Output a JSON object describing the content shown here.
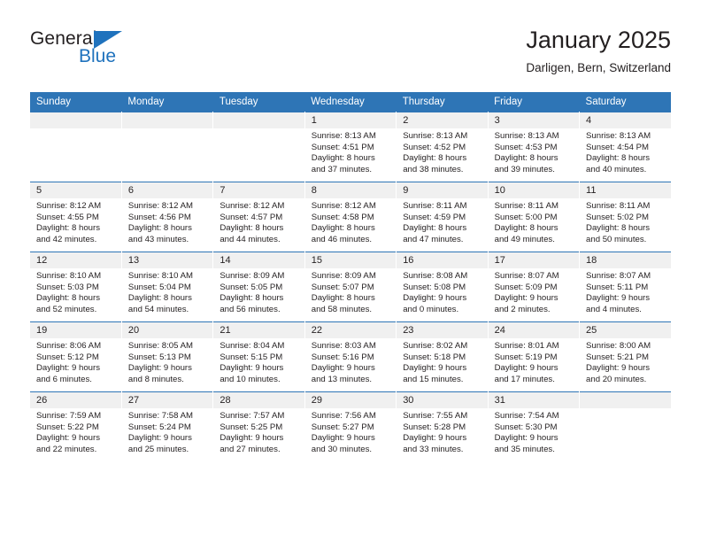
{
  "brand": {
    "name_part1": "General",
    "name_part2": "Blue",
    "accent_color": "#1f72bd"
  },
  "header": {
    "title": "January 2025",
    "subtitle": "Darligen, Bern, Switzerland"
  },
  "calendar": {
    "header_color": "#2e75b6",
    "weekdays": [
      "Sunday",
      "Monday",
      "Tuesday",
      "Wednesday",
      "Thursday",
      "Friday",
      "Saturday"
    ],
    "weeks": [
      [
        {
          "day": "",
          "lines": []
        },
        {
          "day": "",
          "lines": []
        },
        {
          "day": "",
          "lines": []
        },
        {
          "day": "1",
          "lines": [
            "Sunrise: 8:13 AM",
            "Sunset: 4:51 PM",
            "Daylight: 8 hours",
            "and 37 minutes."
          ]
        },
        {
          "day": "2",
          "lines": [
            "Sunrise: 8:13 AM",
            "Sunset: 4:52 PM",
            "Daylight: 8 hours",
            "and 38 minutes."
          ]
        },
        {
          "day": "3",
          "lines": [
            "Sunrise: 8:13 AM",
            "Sunset: 4:53 PM",
            "Daylight: 8 hours",
            "and 39 minutes."
          ]
        },
        {
          "day": "4",
          "lines": [
            "Sunrise: 8:13 AM",
            "Sunset: 4:54 PM",
            "Daylight: 8 hours",
            "and 40 minutes."
          ]
        }
      ],
      [
        {
          "day": "5",
          "lines": [
            "Sunrise: 8:12 AM",
            "Sunset: 4:55 PM",
            "Daylight: 8 hours",
            "and 42 minutes."
          ]
        },
        {
          "day": "6",
          "lines": [
            "Sunrise: 8:12 AM",
            "Sunset: 4:56 PM",
            "Daylight: 8 hours",
            "and 43 minutes."
          ]
        },
        {
          "day": "7",
          "lines": [
            "Sunrise: 8:12 AM",
            "Sunset: 4:57 PM",
            "Daylight: 8 hours",
            "and 44 minutes."
          ]
        },
        {
          "day": "8",
          "lines": [
            "Sunrise: 8:12 AM",
            "Sunset: 4:58 PM",
            "Daylight: 8 hours",
            "and 46 minutes."
          ]
        },
        {
          "day": "9",
          "lines": [
            "Sunrise: 8:11 AM",
            "Sunset: 4:59 PM",
            "Daylight: 8 hours",
            "and 47 minutes."
          ]
        },
        {
          "day": "10",
          "lines": [
            "Sunrise: 8:11 AM",
            "Sunset: 5:00 PM",
            "Daylight: 8 hours",
            "and 49 minutes."
          ]
        },
        {
          "day": "11",
          "lines": [
            "Sunrise: 8:11 AM",
            "Sunset: 5:02 PM",
            "Daylight: 8 hours",
            "and 50 minutes."
          ]
        }
      ],
      [
        {
          "day": "12",
          "lines": [
            "Sunrise: 8:10 AM",
            "Sunset: 5:03 PM",
            "Daylight: 8 hours",
            "and 52 minutes."
          ]
        },
        {
          "day": "13",
          "lines": [
            "Sunrise: 8:10 AM",
            "Sunset: 5:04 PM",
            "Daylight: 8 hours",
            "and 54 minutes."
          ]
        },
        {
          "day": "14",
          "lines": [
            "Sunrise: 8:09 AM",
            "Sunset: 5:05 PM",
            "Daylight: 8 hours",
            "and 56 minutes."
          ]
        },
        {
          "day": "15",
          "lines": [
            "Sunrise: 8:09 AM",
            "Sunset: 5:07 PM",
            "Daylight: 8 hours",
            "and 58 minutes."
          ]
        },
        {
          "day": "16",
          "lines": [
            "Sunrise: 8:08 AM",
            "Sunset: 5:08 PM",
            "Daylight: 9 hours",
            "and 0 minutes."
          ]
        },
        {
          "day": "17",
          "lines": [
            "Sunrise: 8:07 AM",
            "Sunset: 5:09 PM",
            "Daylight: 9 hours",
            "and 2 minutes."
          ]
        },
        {
          "day": "18",
          "lines": [
            "Sunrise: 8:07 AM",
            "Sunset: 5:11 PM",
            "Daylight: 9 hours",
            "and 4 minutes."
          ]
        }
      ],
      [
        {
          "day": "19",
          "lines": [
            "Sunrise: 8:06 AM",
            "Sunset: 5:12 PM",
            "Daylight: 9 hours",
            "and 6 minutes."
          ]
        },
        {
          "day": "20",
          "lines": [
            "Sunrise: 8:05 AM",
            "Sunset: 5:13 PM",
            "Daylight: 9 hours",
            "and 8 minutes."
          ]
        },
        {
          "day": "21",
          "lines": [
            "Sunrise: 8:04 AM",
            "Sunset: 5:15 PM",
            "Daylight: 9 hours",
            "and 10 minutes."
          ]
        },
        {
          "day": "22",
          "lines": [
            "Sunrise: 8:03 AM",
            "Sunset: 5:16 PM",
            "Daylight: 9 hours",
            "and 13 minutes."
          ]
        },
        {
          "day": "23",
          "lines": [
            "Sunrise: 8:02 AM",
            "Sunset: 5:18 PM",
            "Daylight: 9 hours",
            "and 15 minutes."
          ]
        },
        {
          "day": "24",
          "lines": [
            "Sunrise: 8:01 AM",
            "Sunset: 5:19 PM",
            "Daylight: 9 hours",
            "and 17 minutes."
          ]
        },
        {
          "day": "25",
          "lines": [
            "Sunrise: 8:00 AM",
            "Sunset: 5:21 PM",
            "Daylight: 9 hours",
            "and 20 minutes."
          ]
        }
      ],
      [
        {
          "day": "26",
          "lines": [
            "Sunrise: 7:59 AM",
            "Sunset: 5:22 PM",
            "Daylight: 9 hours",
            "and 22 minutes."
          ]
        },
        {
          "day": "27",
          "lines": [
            "Sunrise: 7:58 AM",
            "Sunset: 5:24 PM",
            "Daylight: 9 hours",
            "and 25 minutes."
          ]
        },
        {
          "day": "28",
          "lines": [
            "Sunrise: 7:57 AM",
            "Sunset: 5:25 PM",
            "Daylight: 9 hours",
            "and 27 minutes."
          ]
        },
        {
          "day": "29",
          "lines": [
            "Sunrise: 7:56 AM",
            "Sunset: 5:27 PM",
            "Daylight: 9 hours",
            "and 30 minutes."
          ]
        },
        {
          "day": "30",
          "lines": [
            "Sunrise: 7:55 AM",
            "Sunset: 5:28 PM",
            "Daylight: 9 hours",
            "and 33 minutes."
          ]
        },
        {
          "day": "31",
          "lines": [
            "Sunrise: 7:54 AM",
            "Sunset: 5:30 PM",
            "Daylight: 9 hours",
            "and 35 minutes."
          ]
        },
        {
          "day": "",
          "lines": []
        }
      ]
    ]
  }
}
